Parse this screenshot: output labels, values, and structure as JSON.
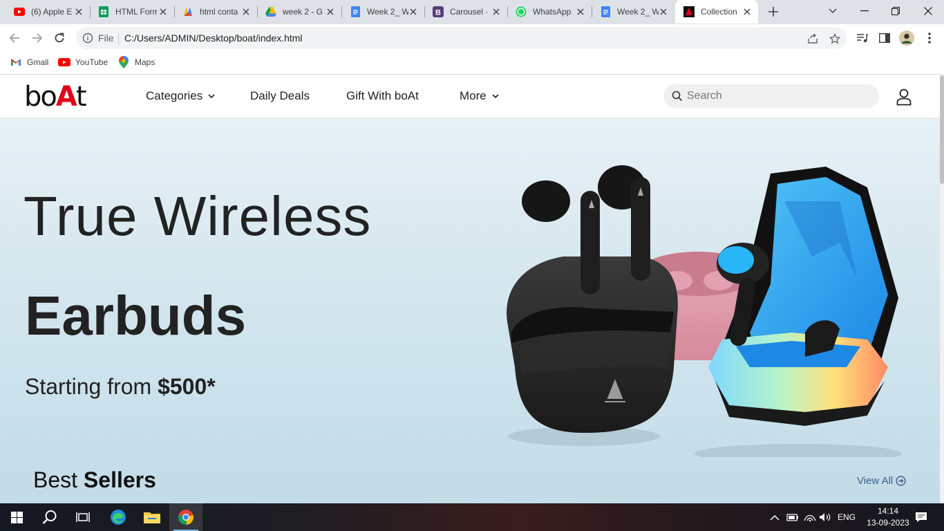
{
  "browser": {
    "tabs": [
      {
        "title": "(6) Apple E",
        "icon": "youtube-icon"
      },
      {
        "title": "HTML Form",
        "icon": "sheets-icon"
      },
      {
        "title": "html conta",
        "icon": "colorful-icon"
      },
      {
        "title": "week 2 - G",
        "icon": "drive-icon"
      },
      {
        "title": "Week 2_ W",
        "icon": "docs-icon"
      },
      {
        "title": "Carousel ·",
        "icon": "bootstrap-icon"
      },
      {
        "title": "WhatsApp",
        "icon": "whatsapp-icon"
      },
      {
        "title": "Week 2_ W",
        "icon": "docs-icon"
      },
      {
        "title": "Collection",
        "icon": "boat-icon",
        "active": true
      }
    ],
    "address": {
      "scheme_label": "File",
      "url": "C:/Users/ADMIN/Desktop/boat/index.html"
    },
    "bookmarks": [
      {
        "label": "Gmail",
        "icon": "gmail-icon"
      },
      {
        "label": "YouTube",
        "icon": "youtube-icon"
      },
      {
        "label": "Maps",
        "icon": "maps-icon"
      }
    ]
  },
  "site": {
    "logo": {
      "part1": "bo",
      "accent": "A",
      "part2": "t"
    },
    "nav": {
      "categories": "Categories",
      "daily_deals": "Daily Deals",
      "gift": "Gift With boAt",
      "more": "More"
    },
    "search_placeholder": "Search",
    "hero": {
      "line1": "True Wireless",
      "line2": "Earbuds",
      "starting_prefix": "Starting from ",
      "price": "$500*"
    },
    "best_sellers": {
      "word1": "Best ",
      "word2": "Sellers"
    },
    "view_all": "View All"
  },
  "taskbar": {
    "language": "ENG",
    "time": "14:14",
    "date": "13-09-2023"
  },
  "colors": {
    "brand_red": "#e3001b",
    "hero_bg": "#cfe3ec",
    "link_blue": "#3a5f8a"
  }
}
